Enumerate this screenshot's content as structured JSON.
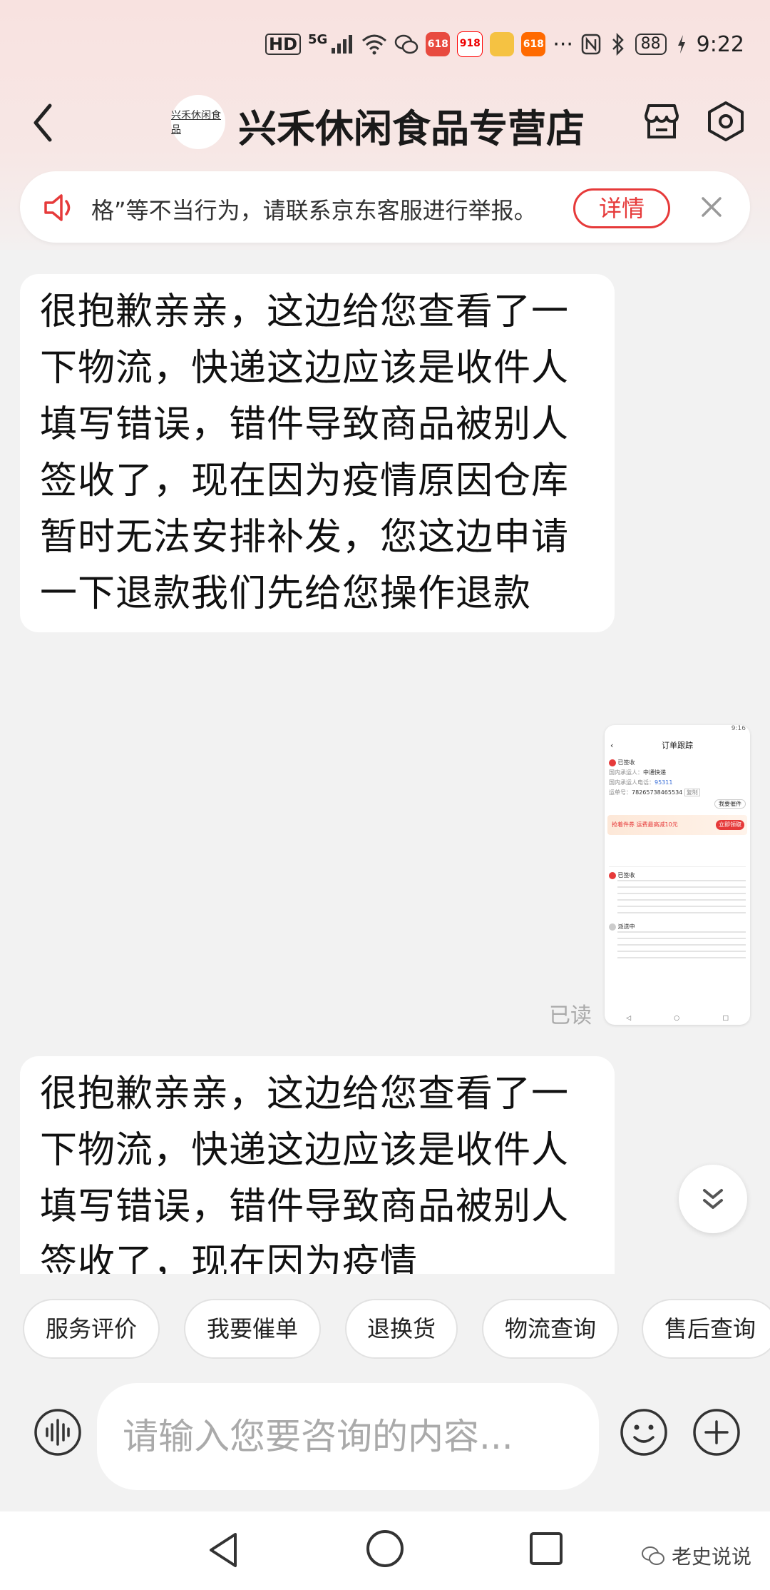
{
  "status_bar": {
    "hd": "HD",
    "network": "5G",
    "app_badges": [
      "618",
      "918",
      "618"
    ],
    "more": "···",
    "battery": "88",
    "time": "9:22"
  },
  "header": {
    "shop_logo_text": "兴禾休闲食品",
    "shop_name": "兴禾休闲食品专营店"
  },
  "notice": {
    "text": "格”等不当行为，请联系京东客服进行举报。",
    "detail_button": "详情"
  },
  "messages": [
    {
      "text": "很抱歉亲亲，这边给您查看了一下物流，快递这边应该是收件人填写错误，错件导致商品被别人签收了，现在因为疫情原因仓库暂时无法安排补发，您这边申请一下退款我们先给您操作退款"
    },
    {
      "text": "很抱歉亲亲，这边给您查看了一下物流，快递这边应该是收件人填写错误，错件导致商品被别人签收了，现在因为疫情"
    }
  ],
  "screenshot_message": {
    "status_time": "9:16",
    "title": "订单跟踪",
    "signed": "已签收",
    "carrier_label": "国内承运人：",
    "carrier": "中通快递",
    "phone_label": "国内承运人电话：",
    "phone": "95311",
    "waybill_label": "运单号：",
    "waybill": "78265738465534",
    "copy": "复制",
    "report_button": "我要催件",
    "promo": "抢着件券 运费最高减10元",
    "promo_button": "立即领取",
    "event_signed": "已签收",
    "event_pending": "派送中",
    "read_status": "已读"
  },
  "quick_replies": [
    "服务评价",
    "我要催单",
    "退换货",
    "物流查询",
    "售后查询"
  ],
  "input": {
    "placeholder": "请输入您要咨询的内容..."
  },
  "watermark": "老史说说",
  "colors": {
    "accent": "#e63a3a",
    "header_bg": "#f8e2e0",
    "chat_bg": "#f2f2f2"
  }
}
